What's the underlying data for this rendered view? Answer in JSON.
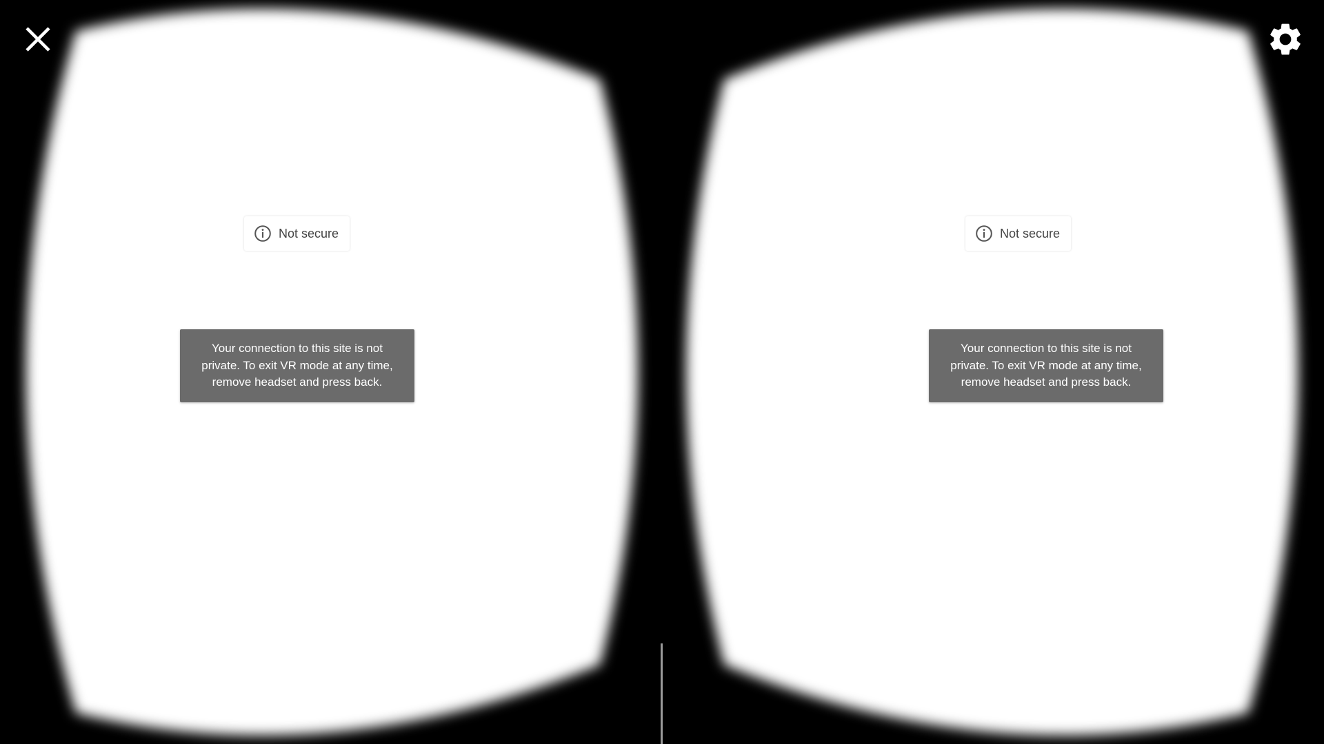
{
  "viewer": {
    "background_color": "#000000",
    "lens_color": "#ffffff",
    "divider_color": "#9a9a9a"
  },
  "eyes": [
    {
      "security_chip": {
        "icon": "info-icon",
        "label": "Not secure"
      },
      "toast": {
        "message": "Your connection to this site is not private. To exit VR mode at any time, remove headset and press back."
      }
    },
    {
      "security_chip": {
        "icon": "info-icon",
        "label": "Not secure"
      },
      "toast": {
        "message": "Your connection to this site is not private. To exit VR mode at any time, remove headset and press back."
      }
    }
  ],
  "controls": {
    "close": {
      "icon": "close-icon"
    },
    "settings": {
      "icon": "gear-icon"
    }
  },
  "colors": {
    "toast_background": "#6b6b6b",
    "toast_text": "#ffffff",
    "chip_text": "#444444",
    "control_icon": "#ffffff"
  }
}
